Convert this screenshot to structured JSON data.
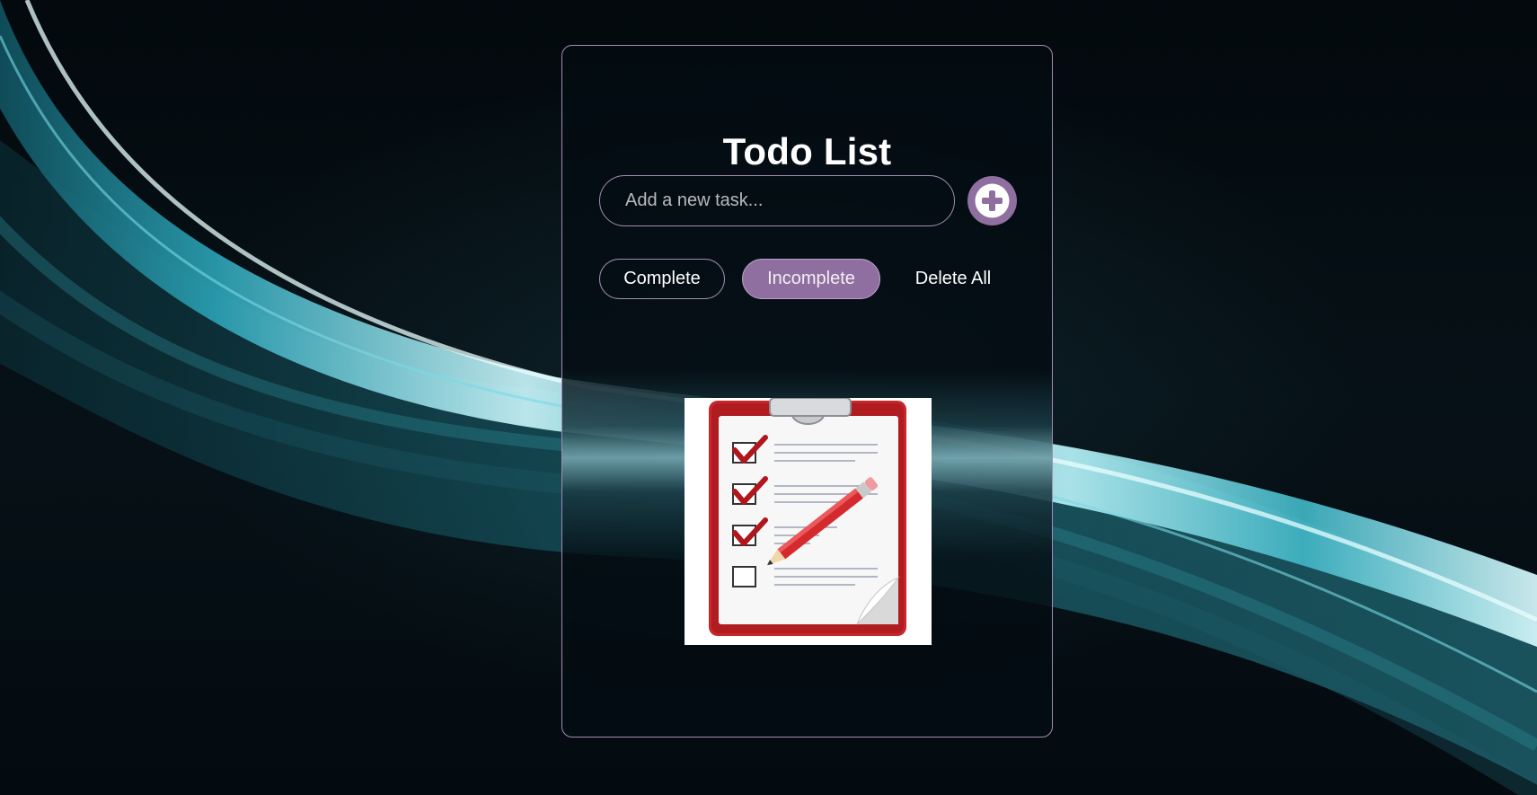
{
  "app": {
    "title": "Todo List"
  },
  "input": {
    "placeholder": "Add a new task...",
    "value": ""
  },
  "add_button": {
    "icon": "plus-circle-icon"
  },
  "filters": {
    "complete_label": "Complete",
    "incomplete_label": "Incomplete",
    "delete_all_label": "Delete All",
    "active": "Incomplete"
  },
  "empty_state": {
    "image": "clipboard-checklist-illustration"
  },
  "colors": {
    "accent": "#8f6f9f",
    "border": "#a58bb4",
    "background": "#050d12",
    "text": "#ffffff",
    "swirl": "#6fd3de"
  }
}
